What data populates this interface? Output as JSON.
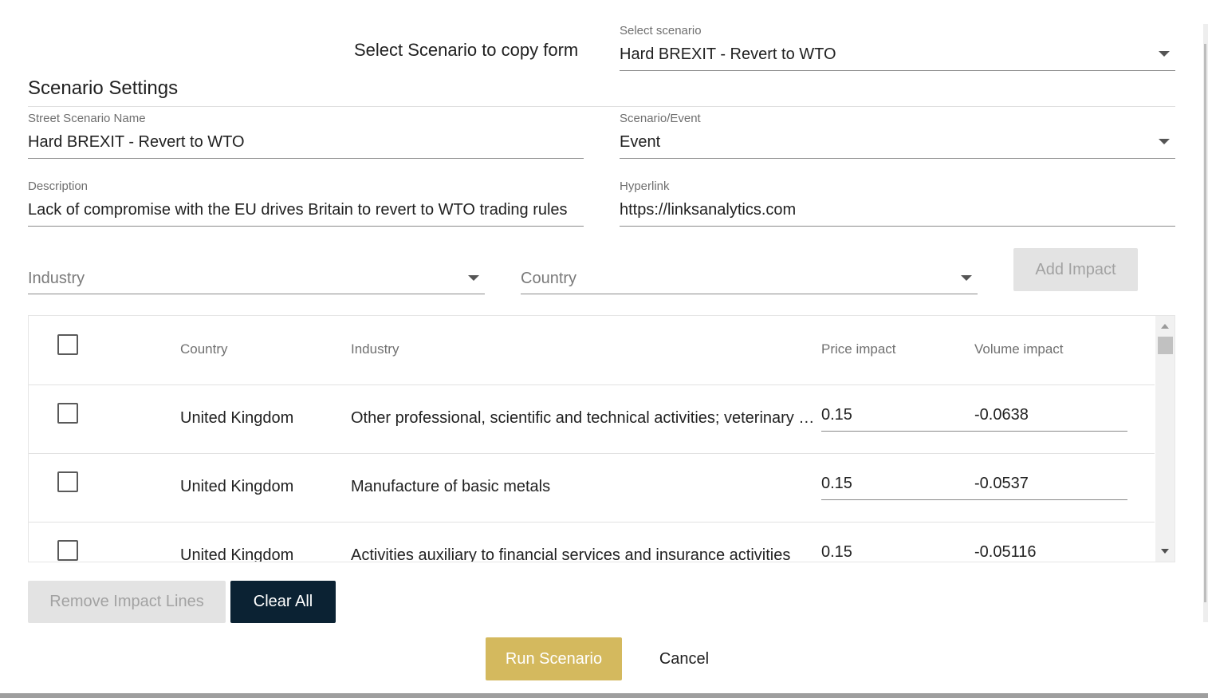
{
  "copy_form": {
    "heading": "Select Scenario to copy form",
    "select_label": "Select scenario",
    "select_value": "Hard BREXIT - Revert to WTO"
  },
  "settings": {
    "title": "Scenario Settings",
    "name_label": "Street Scenario Name",
    "name_value": "Hard BREXIT - Revert to WTO",
    "type_label": "Scenario/Event",
    "type_value": "Event",
    "description_label": "Description",
    "description_value": "Lack of compromise with the EU drives Britain to revert to WTO trading rules",
    "hyperlink_label": "Hyperlink",
    "hyperlink_value": "https://linksanalytics.com"
  },
  "impact_form": {
    "industry_placeholder": "Industry",
    "country_placeholder": "Country",
    "add_impact_label": "Add Impact"
  },
  "table": {
    "headers": {
      "country": "Country",
      "industry": "Industry",
      "price": "Price impact",
      "volume": "Volume impact"
    },
    "rows": [
      {
        "country": "United Kingdom",
        "industry": "Other professional, scientific and technical activities; veterinary activities",
        "price": "0.15",
        "volume": "-0.0638"
      },
      {
        "country": "United Kingdom",
        "industry": "Manufacture of basic metals",
        "price": "0.15",
        "volume": "-0.0537"
      },
      {
        "country": "United Kingdom",
        "industry": "Activities auxiliary to financial services and insurance activities",
        "price": "0.15",
        "volume": "-0.05116"
      }
    ]
  },
  "actions": {
    "remove_label": "Remove Impact Lines",
    "clear_label": "Clear All",
    "run_label": "Run Scenario",
    "cancel_label": "Cancel"
  },
  "colors": {
    "primary_dark": "#0b2233",
    "accent_gold": "#d4b95e",
    "disabled_bg": "#e3e3e3",
    "disabled_text": "#a2a2a2"
  }
}
